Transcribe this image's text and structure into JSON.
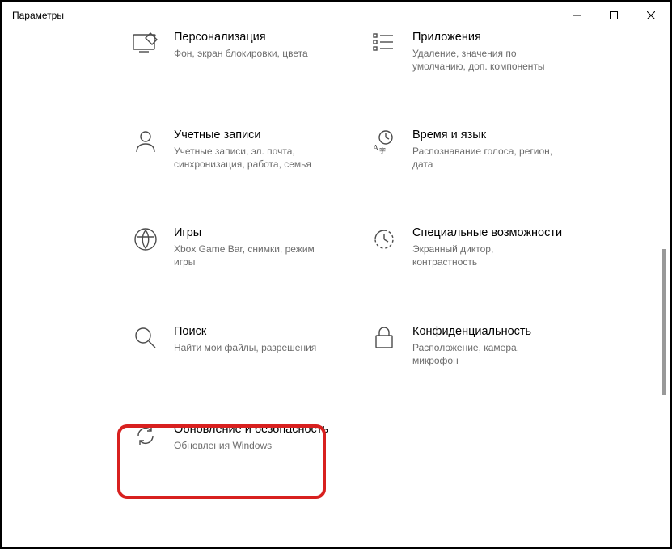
{
  "window": {
    "title": "Параметры"
  },
  "tiles": {
    "personalization": {
      "title": "Персонализация",
      "desc": "Фон, экран блокировки, цвета"
    },
    "apps": {
      "title": "Приложения",
      "desc": "Удаление, значения по умолчанию, доп. компоненты"
    },
    "accounts": {
      "title": "Учетные записи",
      "desc": "Учетные записи, эл. почта, синхронизация, работа, семья"
    },
    "time": {
      "title": "Время и язык",
      "desc": "Распознавание голоса, регион, дата"
    },
    "gaming": {
      "title": "Игры",
      "desc": "Xbox Game Bar, снимки, режим игры"
    },
    "ease": {
      "title": "Специальные возможности",
      "desc": "Экранный диктор, контрастность"
    },
    "search": {
      "title": "Поиск",
      "desc": "Найти мои файлы, разрешения"
    },
    "privacy": {
      "title": "Конфиденциальность",
      "desc": "Расположение, камера, микрофон"
    },
    "update": {
      "title": "Обновление и безопасность",
      "desc": "Обновления Windows"
    }
  }
}
